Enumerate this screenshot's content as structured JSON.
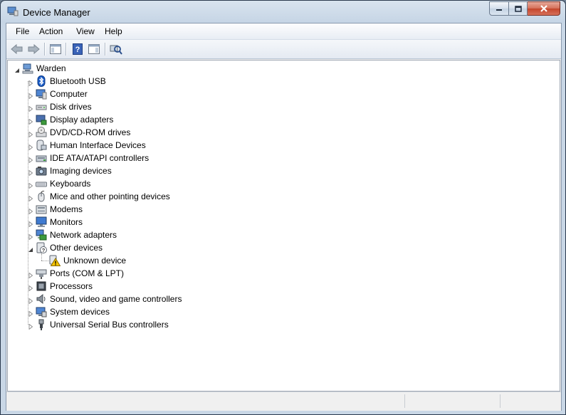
{
  "window": {
    "title": "Device Manager"
  },
  "menu": [
    "File",
    "Action",
    "View",
    "Help"
  ],
  "toolbar": [
    {
      "name": "back-icon"
    },
    {
      "name": "forward-icon"
    },
    {
      "name": "show-hide-console-tree-icon"
    },
    {
      "name": "help-icon"
    },
    {
      "name": "properties-pane-icon"
    },
    {
      "name": "scan-hardware-icon"
    }
  ],
  "tree": {
    "root": {
      "label": "Warden",
      "icon": "computer-root-icon",
      "expanded": true
    },
    "categories": [
      {
        "label": "Bluetooth USB",
        "icon": "bluetooth-icon",
        "expanded": false
      },
      {
        "label": "Computer",
        "icon": "computer-icon",
        "expanded": false
      },
      {
        "label": "Disk drives",
        "icon": "disk-drive-icon",
        "expanded": false
      },
      {
        "label": "Display adapters",
        "icon": "display-adapter-icon",
        "expanded": false
      },
      {
        "label": "DVD/CD-ROM drives",
        "icon": "dvd-drive-icon",
        "expanded": false
      },
      {
        "label": "Human Interface Devices",
        "icon": "hid-icon",
        "expanded": false
      },
      {
        "label": "IDE ATA/ATAPI controllers",
        "icon": "ide-controller-icon",
        "expanded": false
      },
      {
        "label": "Imaging devices",
        "icon": "camera-icon",
        "expanded": false
      },
      {
        "label": "Keyboards",
        "icon": "keyboard-icon",
        "expanded": false
      },
      {
        "label": "Mice and other pointing devices",
        "icon": "mouse-icon",
        "expanded": false
      },
      {
        "label": "Modems",
        "icon": "modem-icon",
        "expanded": false
      },
      {
        "label": "Monitors",
        "icon": "monitor-icon",
        "expanded": false
      },
      {
        "label": "Network adapters",
        "icon": "network-icon",
        "expanded": false
      },
      {
        "label": "Other devices",
        "icon": "other-devices-icon",
        "expanded": true,
        "children": [
          {
            "label": "Unknown device",
            "icon": "unknown-device-warning-icon"
          }
        ]
      },
      {
        "label": "Ports (COM & LPT)",
        "icon": "port-icon",
        "expanded": false
      },
      {
        "label": "Processors",
        "icon": "processor-icon",
        "expanded": false
      },
      {
        "label": "Sound, video and game controllers",
        "icon": "sound-icon",
        "expanded": false
      },
      {
        "label": "System devices",
        "icon": "system-devices-icon",
        "expanded": false
      },
      {
        "label": "Universal Serial Bus controllers",
        "icon": "usb-icon",
        "expanded": false
      }
    ]
  },
  "colors": {
    "title_bar": "#c6d5e5",
    "close_button": "#c4452b",
    "warning": "#f5c400"
  }
}
